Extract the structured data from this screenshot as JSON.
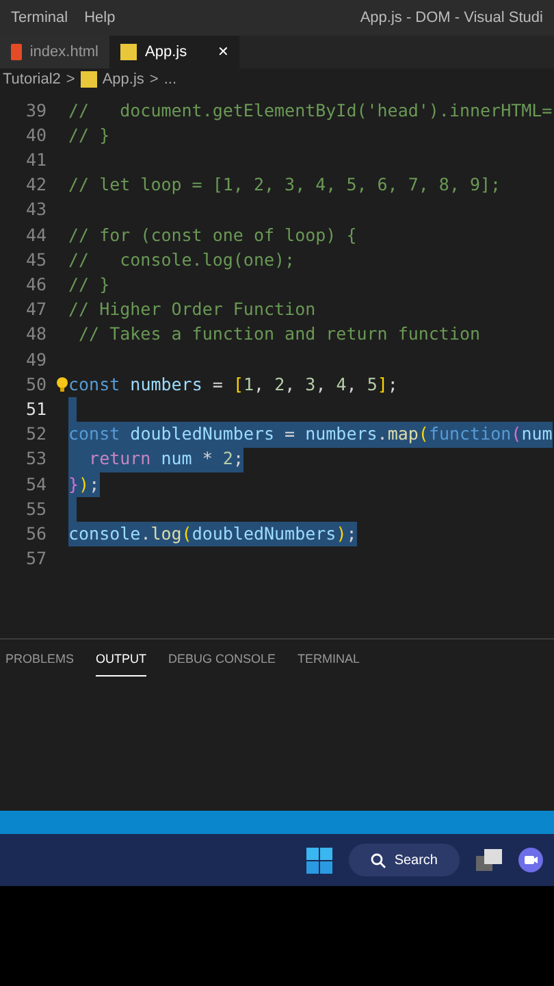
{
  "menu": [
    "Terminal",
    "Help"
  ],
  "window": {
    "title": "App.js - DOM - Visual Studi"
  },
  "tabs": [
    {
      "label": "index.html",
      "kind": "html",
      "selected": false
    },
    {
      "label": "App.js",
      "kind": "js",
      "selected": true,
      "close": "✕"
    }
  ],
  "breadcrumb": {
    "folder": "Tutorial2",
    "sep1": ">",
    "file": "App.js",
    "sep2": ">",
    "rest": "..."
  },
  "lines": [
    {
      "num": "39",
      "current": false,
      "selected": false,
      "bulb": false,
      "tokens": [
        {
          "t": "//   document.getElementById('head').innerHTML=",
          "kind": "comment"
        }
      ]
    },
    {
      "num": "40",
      "current": false,
      "selected": false,
      "bulb": false,
      "tokens": [
        {
          "t": "// }",
          "kind": "comment"
        }
      ]
    },
    {
      "num": "41",
      "current": false,
      "selected": false,
      "bulb": false
    },
    {
      "num": "42",
      "current": false,
      "selected": false,
      "bulb": false,
      "tokens": [
        {
          "t": "// let loop = [1, 2, 3, 4, 5, 6, 7, 8, 9];",
          "kind": "comment"
        }
      ]
    },
    {
      "num": "43",
      "current": false,
      "selected": false,
      "bulb": false
    },
    {
      "num": "44",
      "current": false,
      "selected": false,
      "bulb": false,
      "tokens": [
        {
          "t": "// for (const one of loop) {",
          "kind": "comment"
        }
      ]
    },
    {
      "num": "45",
      "current": false,
      "selected": false,
      "bulb": false,
      "tokens": [
        {
          "t": "//   console.log(one);",
          "kind": "comment"
        }
      ]
    },
    {
      "num": "46",
      "current": false,
      "selected": false,
      "bulb": false,
      "tokens": [
        {
          "t": "// }",
          "kind": "comment"
        }
      ]
    },
    {
      "num": "47",
      "current": false,
      "selected": false,
      "bulb": false,
      "tokens": [
        {
          "t": "// Higher Order Function",
          "kind": "comment"
        }
      ]
    },
    {
      "num": "48",
      "current": false,
      "selected": false,
      "bulb": false,
      "tokens": [
        {
          "t": " // Takes a function and return function",
          "kind": "comment"
        }
      ]
    },
    {
      "num": "49",
      "current": false,
      "selected": false,
      "bulb": false
    },
    {
      "num": "50",
      "current": false,
      "selected": false,
      "bulb": true,
      "tokens": [
        {
          "t": "const",
          "kind": "keyword"
        },
        {
          "t": " numbers",
          "kind": "variable"
        },
        {
          "t": " = ",
          "kind": "plain"
        },
        {
          "t": "[",
          "kind": "bracket"
        },
        {
          "t": "1",
          "kind": "number"
        },
        {
          "t": ", ",
          "kind": "plain"
        },
        {
          "t": "2",
          "kind": "number"
        },
        {
          "t": ", ",
          "kind": "plain"
        },
        {
          "t": "3",
          "kind": "number"
        },
        {
          "t": ", ",
          "kind": "plain"
        },
        {
          "t": "4",
          "kind": "number"
        },
        {
          "t": ", ",
          "kind": "plain"
        },
        {
          "t": "5",
          "kind": "number"
        },
        {
          "t": "]",
          "kind": "bracket"
        },
        {
          "t": ";",
          "kind": "plain"
        }
      ]
    },
    {
      "num": "51",
      "current": true,
      "selected": true,
      "bulb": false
    },
    {
      "num": "52",
      "current": false,
      "selected": true,
      "bulb": false,
      "tokens": [
        {
          "t": "const",
          "kind": "keyword"
        },
        {
          "t": " doubledNumbers",
          "kind": "variable"
        },
        {
          "t": " = ",
          "kind": "plain"
        },
        {
          "t": "numbers",
          "kind": "variable"
        },
        {
          "t": ".",
          "kind": "plain"
        },
        {
          "t": "map",
          "kind": "function"
        },
        {
          "t": "(",
          "kind": "bracket"
        },
        {
          "t": "function",
          "kind": "keyword"
        },
        {
          "t": "(",
          "kind": "bracket2"
        },
        {
          "t": "num",
          "kind": "variable"
        }
      ]
    },
    {
      "num": "53",
      "current": false,
      "selected": true,
      "bulb": false,
      "tokens": [
        {
          "t": "  return",
          "kind": "control"
        },
        {
          "t": " num",
          "kind": "variable"
        },
        {
          "t": " * ",
          "kind": "plain"
        },
        {
          "t": "2",
          "kind": "number"
        },
        {
          "t": ";",
          "kind": "plain"
        }
      ]
    },
    {
      "num": "54",
      "current": false,
      "selected": true,
      "bulb": false,
      "tokens": [
        {
          "t": "}",
          "kind": "bracket2"
        },
        {
          "t": ")",
          "kind": "bracket"
        },
        {
          "t": ";",
          "kind": "plain"
        }
      ]
    },
    {
      "num": "55",
      "current": false,
      "selected": true,
      "bulb": false
    },
    {
      "num": "56",
      "current": false,
      "selected": true,
      "bulb": false,
      "tokens": [
        {
          "t": "console",
          "kind": "variable"
        },
        {
          "t": ".",
          "kind": "plain"
        },
        {
          "t": "log",
          "kind": "function"
        },
        {
          "t": "(",
          "kind": "bracket"
        },
        {
          "t": "doubledNumbers",
          "kind": "variable"
        },
        {
          "t": ")",
          "kind": "bracket"
        },
        {
          "t": ";",
          "kind": "plain"
        }
      ]
    },
    {
      "num": "57",
      "current": false,
      "selected": false,
      "bulb": false
    }
  ],
  "panel_tabs": [
    {
      "label": "PROBLEMS",
      "selected": false
    },
    {
      "label": "OUTPUT",
      "selected": true
    },
    {
      "label": "DEBUG CONSOLE",
      "selected": false
    },
    {
      "label": "TERMINAL",
      "selected": false
    }
  ],
  "taskbar": {
    "search": "Search"
  }
}
